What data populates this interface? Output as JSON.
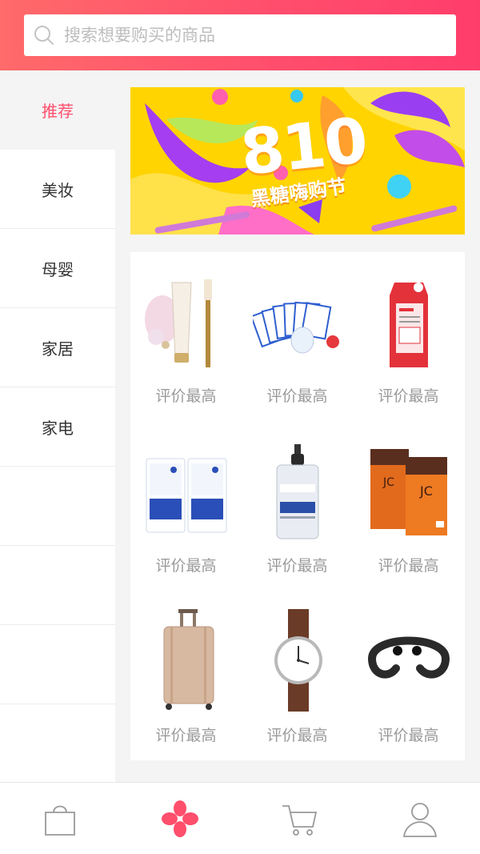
{
  "search": {
    "placeholder": "搜索想要购买的商品"
  },
  "sidebar": {
    "items": [
      {
        "label": "推荐",
        "active": true
      },
      {
        "label": "美妆"
      },
      {
        "label": "母婴"
      },
      {
        "label": "家居"
      },
      {
        "label": "家电"
      },
      {
        "label": ""
      },
      {
        "label": ""
      },
      {
        "label": ""
      },
      {
        "label": ""
      }
    ]
  },
  "banner": {
    "number": "810",
    "caption": "黑糖嗨购节"
  },
  "products": [
    {
      "label": "评价最高",
      "image": "cream-tube-and-brush"
    },
    {
      "label": "评价最高",
      "image": "face-mask-pack"
    },
    {
      "label": "评价最高",
      "image": "red-sheet-mask"
    },
    {
      "label": "评价最高",
      "image": "nmf-mask-box"
    },
    {
      "label": "评价最高",
      "image": "serum-bottle"
    },
    {
      "label": "评价最高",
      "image": "orange-mask-box"
    },
    {
      "label": "评价最高",
      "image": "luggage"
    },
    {
      "label": "评价最高",
      "image": "wrist-watch"
    },
    {
      "label": "评价最高",
      "image": "neckband-headphones"
    }
  ],
  "tabbar": {
    "items": [
      {
        "icon": "shopping-bag-icon"
      },
      {
        "icon": "flower-home-icon",
        "active": true
      },
      {
        "icon": "cart-icon"
      },
      {
        "icon": "user-icon"
      }
    ]
  },
  "colors": {
    "accent": "#ff4f6d",
    "banner_bg": "#ffd400"
  }
}
